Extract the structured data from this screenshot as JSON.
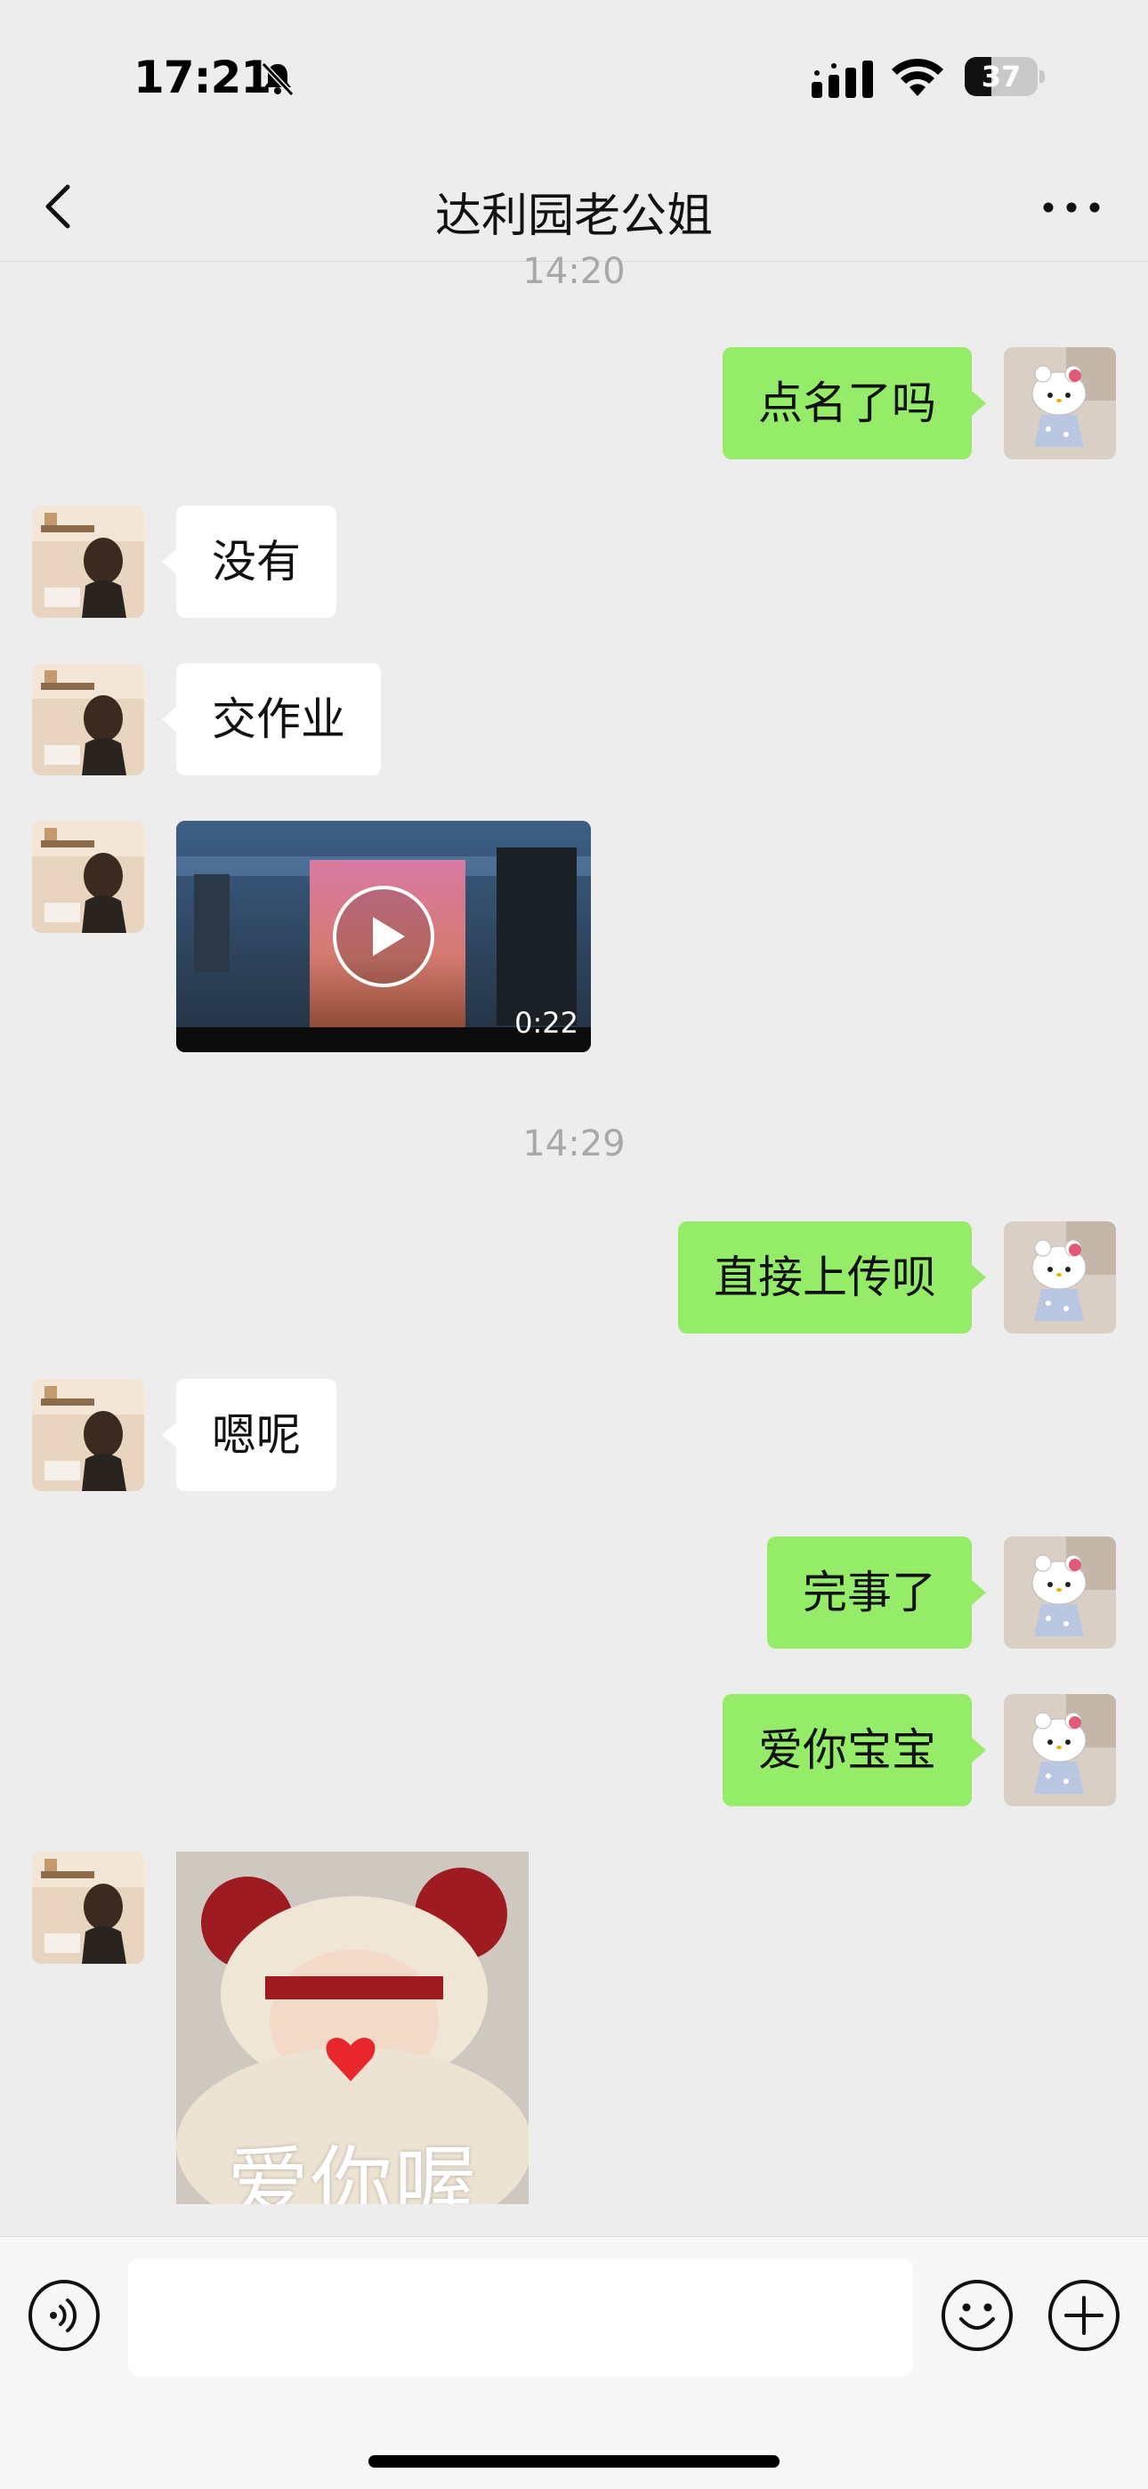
{
  "status_bar": {
    "time": "17:21",
    "battery": "37",
    "battery_level": 0.37
  },
  "header": {
    "title": "达利园老公姐"
  },
  "messages": [
    {
      "type": "timestamp",
      "text": "14:20"
    },
    {
      "type": "text",
      "sender": "me",
      "text": "点名了吗"
    },
    {
      "type": "text",
      "sender": "them",
      "text": "没有"
    },
    {
      "type": "text",
      "sender": "them",
      "text": "交作业"
    },
    {
      "type": "video",
      "sender": "them",
      "duration": "0:22"
    },
    {
      "type": "timestamp",
      "text": "14:29"
    },
    {
      "type": "text",
      "sender": "me",
      "text": "直接上传呗"
    },
    {
      "type": "text",
      "sender": "them",
      "text": "嗯呢"
    },
    {
      "type": "text",
      "sender": "me",
      "text": "完事了"
    },
    {
      "type": "text",
      "sender": "me",
      "text": "爱你宝宝"
    },
    {
      "type": "sticker",
      "sender": "them",
      "caption": "爱你喔"
    }
  ],
  "input_bar": {
    "placeholder": ""
  },
  "icons": {
    "status": [
      "bell-slash-icon",
      "signal-icon",
      "wifi-icon",
      "battery-icon"
    ],
    "nav": [
      "back-chevron-icon",
      "more-dots-icon"
    ],
    "input": [
      "voice-icon",
      "emoji-icon",
      "plus-icon"
    ],
    "video": [
      "play-icon"
    ]
  },
  "colors": {
    "background": "#ededed",
    "my_bubble": "#95ec69",
    "their_bubble": "#ffffff",
    "timestamp": "#a8a8a8"
  }
}
